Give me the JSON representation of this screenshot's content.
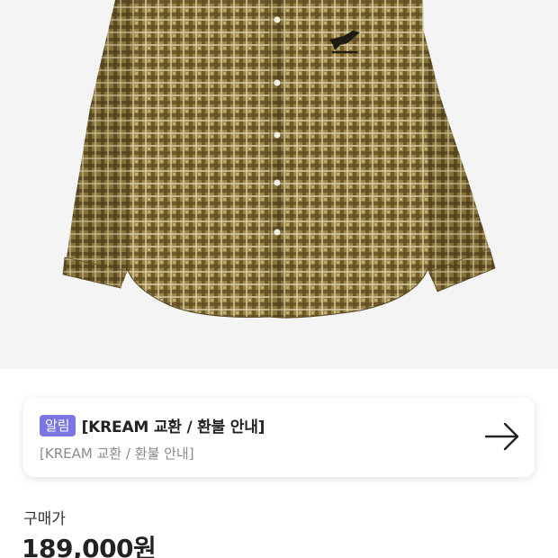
{
  "product": {
    "image_alt": "plaid shirt",
    "shirt_colors": [
      "#8f7a3c",
      "#5b4a22",
      "#b8a66f",
      "#d9cfae"
    ]
  },
  "notice": {
    "badge": "알림",
    "title": "[KREAM 교환 / 환불 안내]",
    "subtitle": "[KREAM 교환 / 환불 안내]",
    "arrow_icon": "arrow-right-icon"
  },
  "price": {
    "label": "구매가",
    "value": "189,000원"
  },
  "colors": {
    "badge_bg": "#7a75e3",
    "image_bg": "#f4f4f4"
  }
}
